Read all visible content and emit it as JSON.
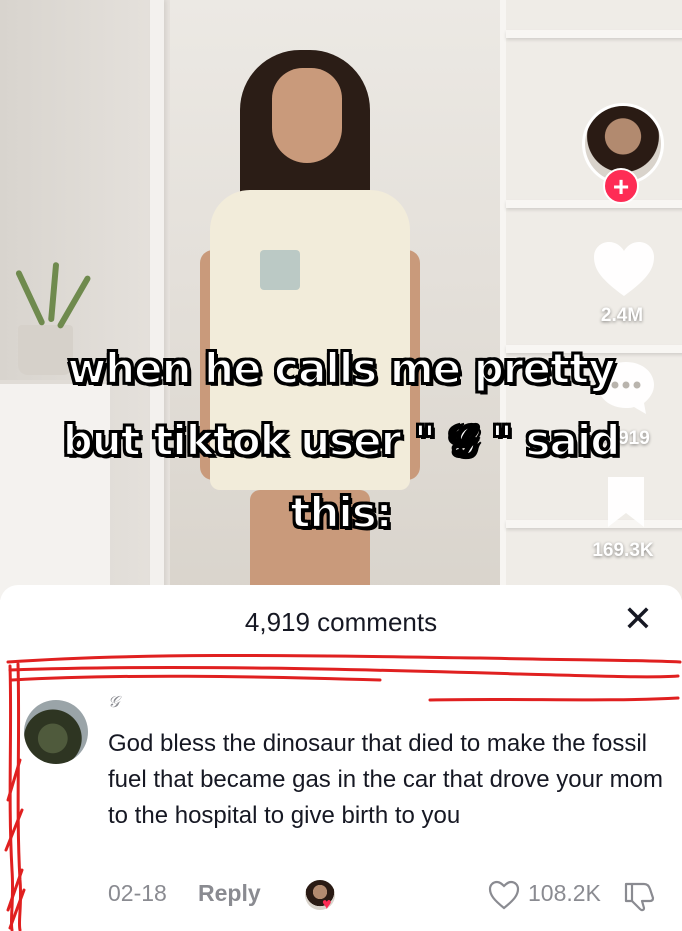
{
  "video": {
    "like_count": "2.4M",
    "comment_count": "4,919",
    "save_count": "169.3K",
    "follow_symbol": "+"
  },
  "caption": {
    "line1": "when he calls me pretty",
    "line2": "but tiktok user \" 𝒢 \" said",
    "line3": "this:"
  },
  "comments_sheet": {
    "title": "4,919 comments",
    "close_symbol": "✕",
    "comment": {
      "username": "𝒢",
      "text": "God bless the dinosaur that died to make the fossil fuel that became gas in the car that drove your mom to the hospital to give birth to you",
      "date": "02-18",
      "reply_label": "Reply",
      "like_count": "108.2K",
      "creator_liked": true
    }
  },
  "colors": {
    "accent": "#fe2c55",
    "text_primary": "#161823",
    "text_secondary": "#8a8b91",
    "annotation_red": "#e02020"
  },
  "icons": {
    "like": "heart-icon",
    "comment": "speech-bubble-icon",
    "save": "bookmark-icon",
    "close": "close-icon",
    "comment_like": "heart-outline-icon",
    "comment_dislike": "thumbs-down-icon"
  }
}
